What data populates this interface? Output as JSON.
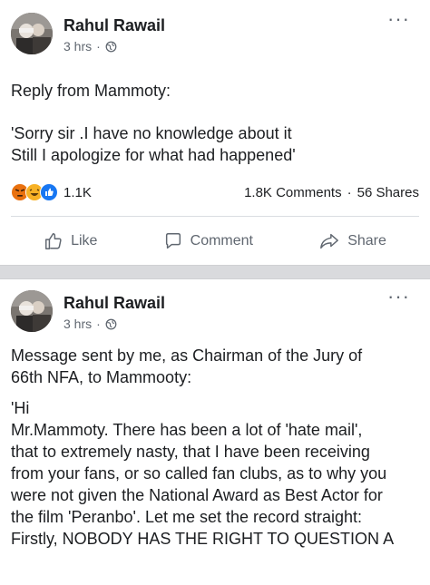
{
  "post1": {
    "author": "Rahul Rawail",
    "time": "3 hrs",
    "meta_separator": "·",
    "text_lines_1": [
      "Reply from Mammoty:"
    ],
    "text_lines_2": [
      "'Sorry sir .I have no knowledge about it",
      "Still I apologize for what had happened'"
    ],
    "reactions": {
      "icons": [
        "angry-icon",
        "haha-icon",
        "like-icon"
      ],
      "count": "1.1K"
    },
    "comments": "1.8K Comments",
    "stats_separator": "·",
    "shares": "56 Shares",
    "actions": {
      "like": "Like",
      "comment": "Comment",
      "share": "Share"
    },
    "more": "···"
  },
  "post2": {
    "author": "Rahul Rawail",
    "time": "3 hrs",
    "meta_separator": "·",
    "text_lines_1": [
      "Message sent by me, as Chairman of the Jury of",
      "66th NFA, to Mammooty:"
    ],
    "text_lines_2": [
      "'Hi",
      "Mr.Mammoty. There has been a lot of 'hate mail',",
      "that to extremely nasty, that I have been receiving",
      "from your fans, or so called fan clubs, as to why you",
      "were not given the National Award as Best Actor for",
      "the film 'Peranbo'.  Let me set the record straight:",
      "Firstly, NOBODY HAS THE RIGHT TO QUESTION A"
    ],
    "more": "···"
  },
  "colors": {
    "text": "#1c1e21",
    "secondary": "#606770",
    "divider": "#d9dadd",
    "like_blue": "#1877f2",
    "angry_orange": "#e9710f",
    "haha_yellow": "#f7b125"
  }
}
